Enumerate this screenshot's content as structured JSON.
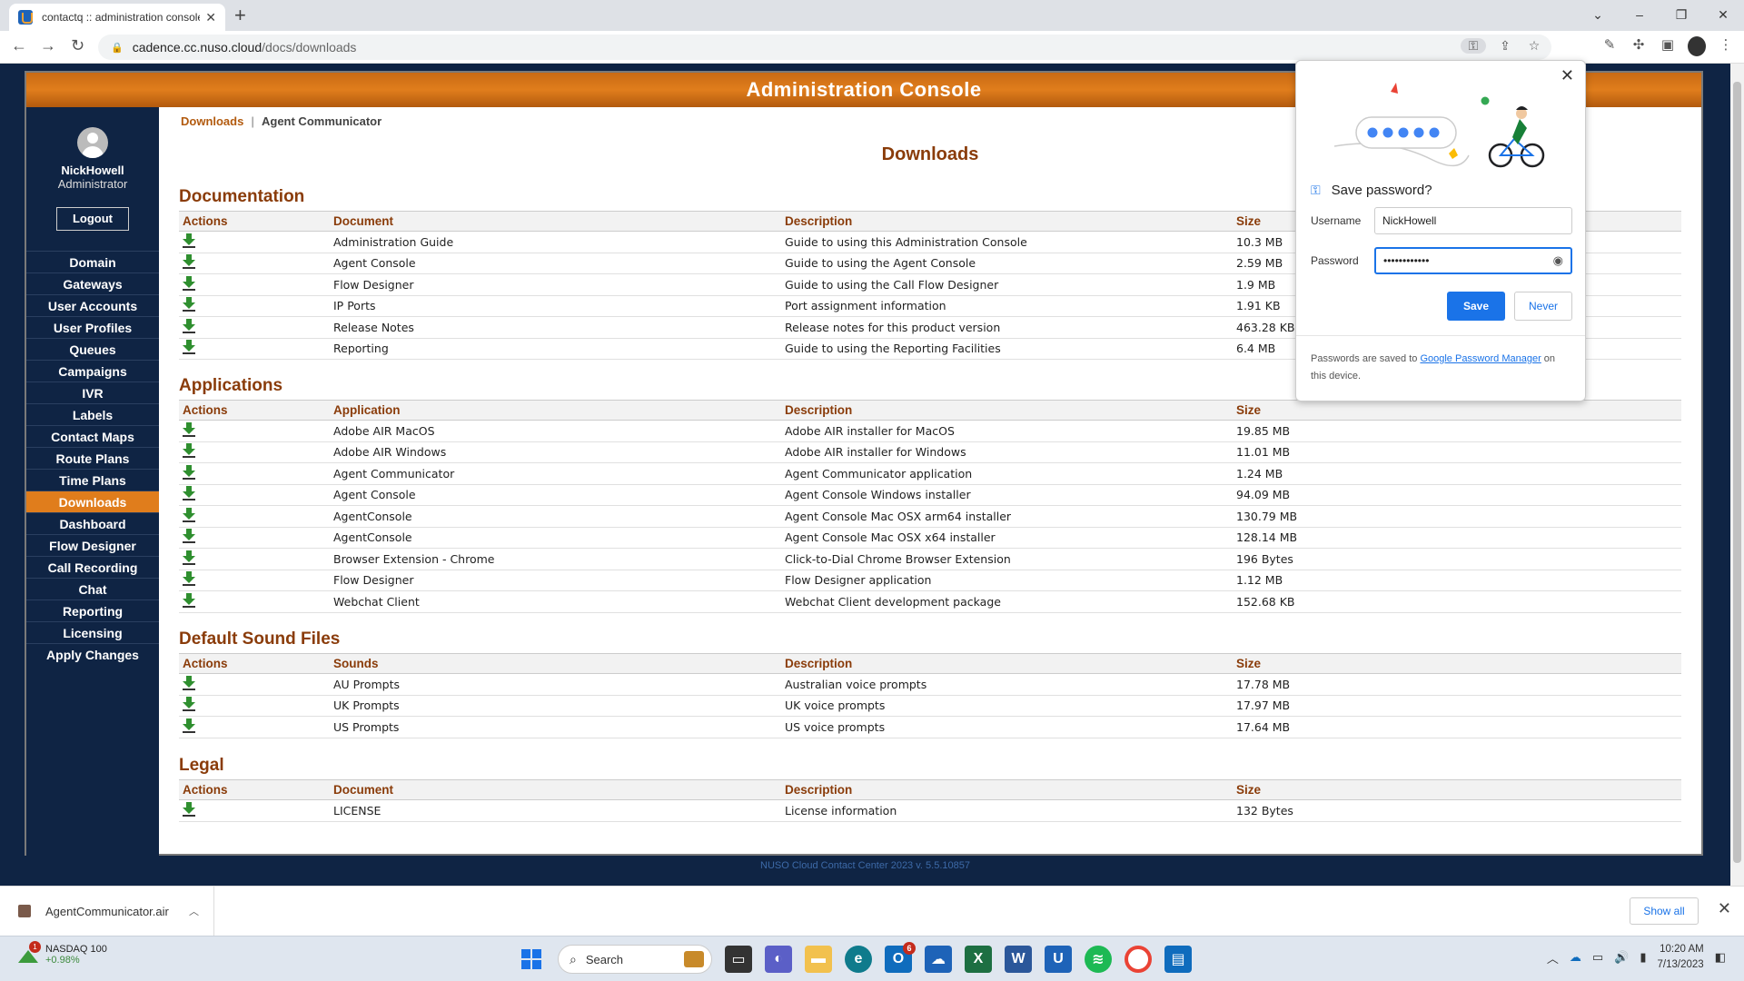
{
  "browser": {
    "tab_title": "contactq :: administration console",
    "url_host": "cadence.cc.nuso.cloud",
    "url_path": "/docs/downloads"
  },
  "console": {
    "header": "Administration Console",
    "user_name": "NickHowell",
    "user_role": "Administrator",
    "logout_label": "Logout",
    "menu": [
      "Domain",
      "Gateways",
      "User Accounts",
      "User Profiles",
      "Queues",
      "Campaigns",
      "IVR",
      "Labels",
      "Contact Maps",
      "Route Plans",
      "Time Plans",
      "Downloads",
      "Dashboard",
      "Flow Designer",
      "Call Recording",
      "Chat",
      "Reporting",
      "Licensing",
      "Apply Changes"
    ],
    "active_menu": "Downloads",
    "subnav_active": "Downloads",
    "subnav_link": "Agent Communicator",
    "page_title": "Downloads",
    "footer": "NUSO Cloud Contact Center 2023 v. 5.5.10857"
  },
  "sections": {
    "documentation": {
      "title": "Documentation",
      "headers": [
        "Actions",
        "Document",
        "Description",
        "Size"
      ],
      "rows": [
        [
          "Administration Guide",
          "Guide to using this Administration Console",
          "10.3 MB"
        ],
        [
          "Agent Console",
          "Guide to using the Agent Console",
          "2.59 MB"
        ],
        [
          "Flow Designer",
          "Guide to using the Call Flow Designer",
          "1.9 MB"
        ],
        [
          "IP Ports",
          "Port assignment information",
          "1.91 KB"
        ],
        [
          "Release Notes",
          "Release notes for this product version",
          "463.28 KB"
        ],
        [
          "Reporting",
          "Guide to using the Reporting Facilities",
          "6.4 MB"
        ]
      ]
    },
    "applications": {
      "title": "Applications",
      "headers": [
        "Actions",
        "Application",
        "Description",
        "Size"
      ],
      "rows": [
        [
          "Adobe AIR MacOS",
          "Adobe AIR installer for MacOS",
          "19.85 MB"
        ],
        [
          "Adobe AIR Windows",
          "Adobe AIR installer for Windows",
          "11.01 MB"
        ],
        [
          "Agent Communicator",
          "Agent Communicator application",
          "1.24 MB"
        ],
        [
          "Agent Console",
          "Agent Console Windows installer",
          "94.09 MB"
        ],
        [
          "AgentConsole",
          "Agent Console Mac OSX arm64 installer",
          "130.79 MB"
        ],
        [
          "AgentConsole",
          "Agent Console Mac OSX x64 installer",
          "128.14 MB"
        ],
        [
          "Browser Extension - Chrome",
          "Click-to-Dial Chrome Browser Extension",
          "196 Bytes"
        ],
        [
          "Flow Designer",
          "Flow Designer application",
          "1.12 MB"
        ],
        [
          "Webchat Client",
          "Webchat Client development package",
          "152.68 KB"
        ]
      ]
    },
    "sounds": {
      "title": "Default Sound Files",
      "headers": [
        "Actions",
        "Sounds",
        "Description",
        "Size"
      ],
      "rows": [
        [
          "AU Prompts",
          "Australian voice prompts",
          "17.78 MB"
        ],
        [
          "UK Prompts",
          "UK voice prompts",
          "17.97 MB"
        ],
        [
          "US Prompts",
          "US voice prompts",
          "17.64 MB"
        ]
      ]
    },
    "legal": {
      "title": "Legal",
      "headers": [
        "Actions",
        "Document",
        "Description",
        "Size"
      ],
      "rows": [
        [
          "LICENSE",
          "License information",
          "132 Bytes"
        ]
      ]
    }
  },
  "password_popup": {
    "title": "Save password?",
    "username_label": "Username",
    "username_value": "NickHowell",
    "password_label": "Password",
    "password_value": "••••••••••••",
    "save_label": "Save",
    "never_label": "Never",
    "footer_prefix": "Passwords are saved to ",
    "footer_link": "Google Password Manager",
    "footer_suffix": " on this device."
  },
  "download_bar": {
    "file_name": "AgentCommunicator.air",
    "show_all": "Show all"
  },
  "taskbar": {
    "stock_name": "NASDAQ 100",
    "stock_change": "+0.98%",
    "stock_badge": "1",
    "search_label": "Search",
    "outlook_badge": "6",
    "time": "10:20 AM",
    "date": "7/13/2023"
  },
  "colors": {
    "header_orange": "#e07d1c",
    "sidebar_navy": "#0f2444",
    "section_brown": "#8a3c0a",
    "chrome_blue": "#1a73e8"
  }
}
